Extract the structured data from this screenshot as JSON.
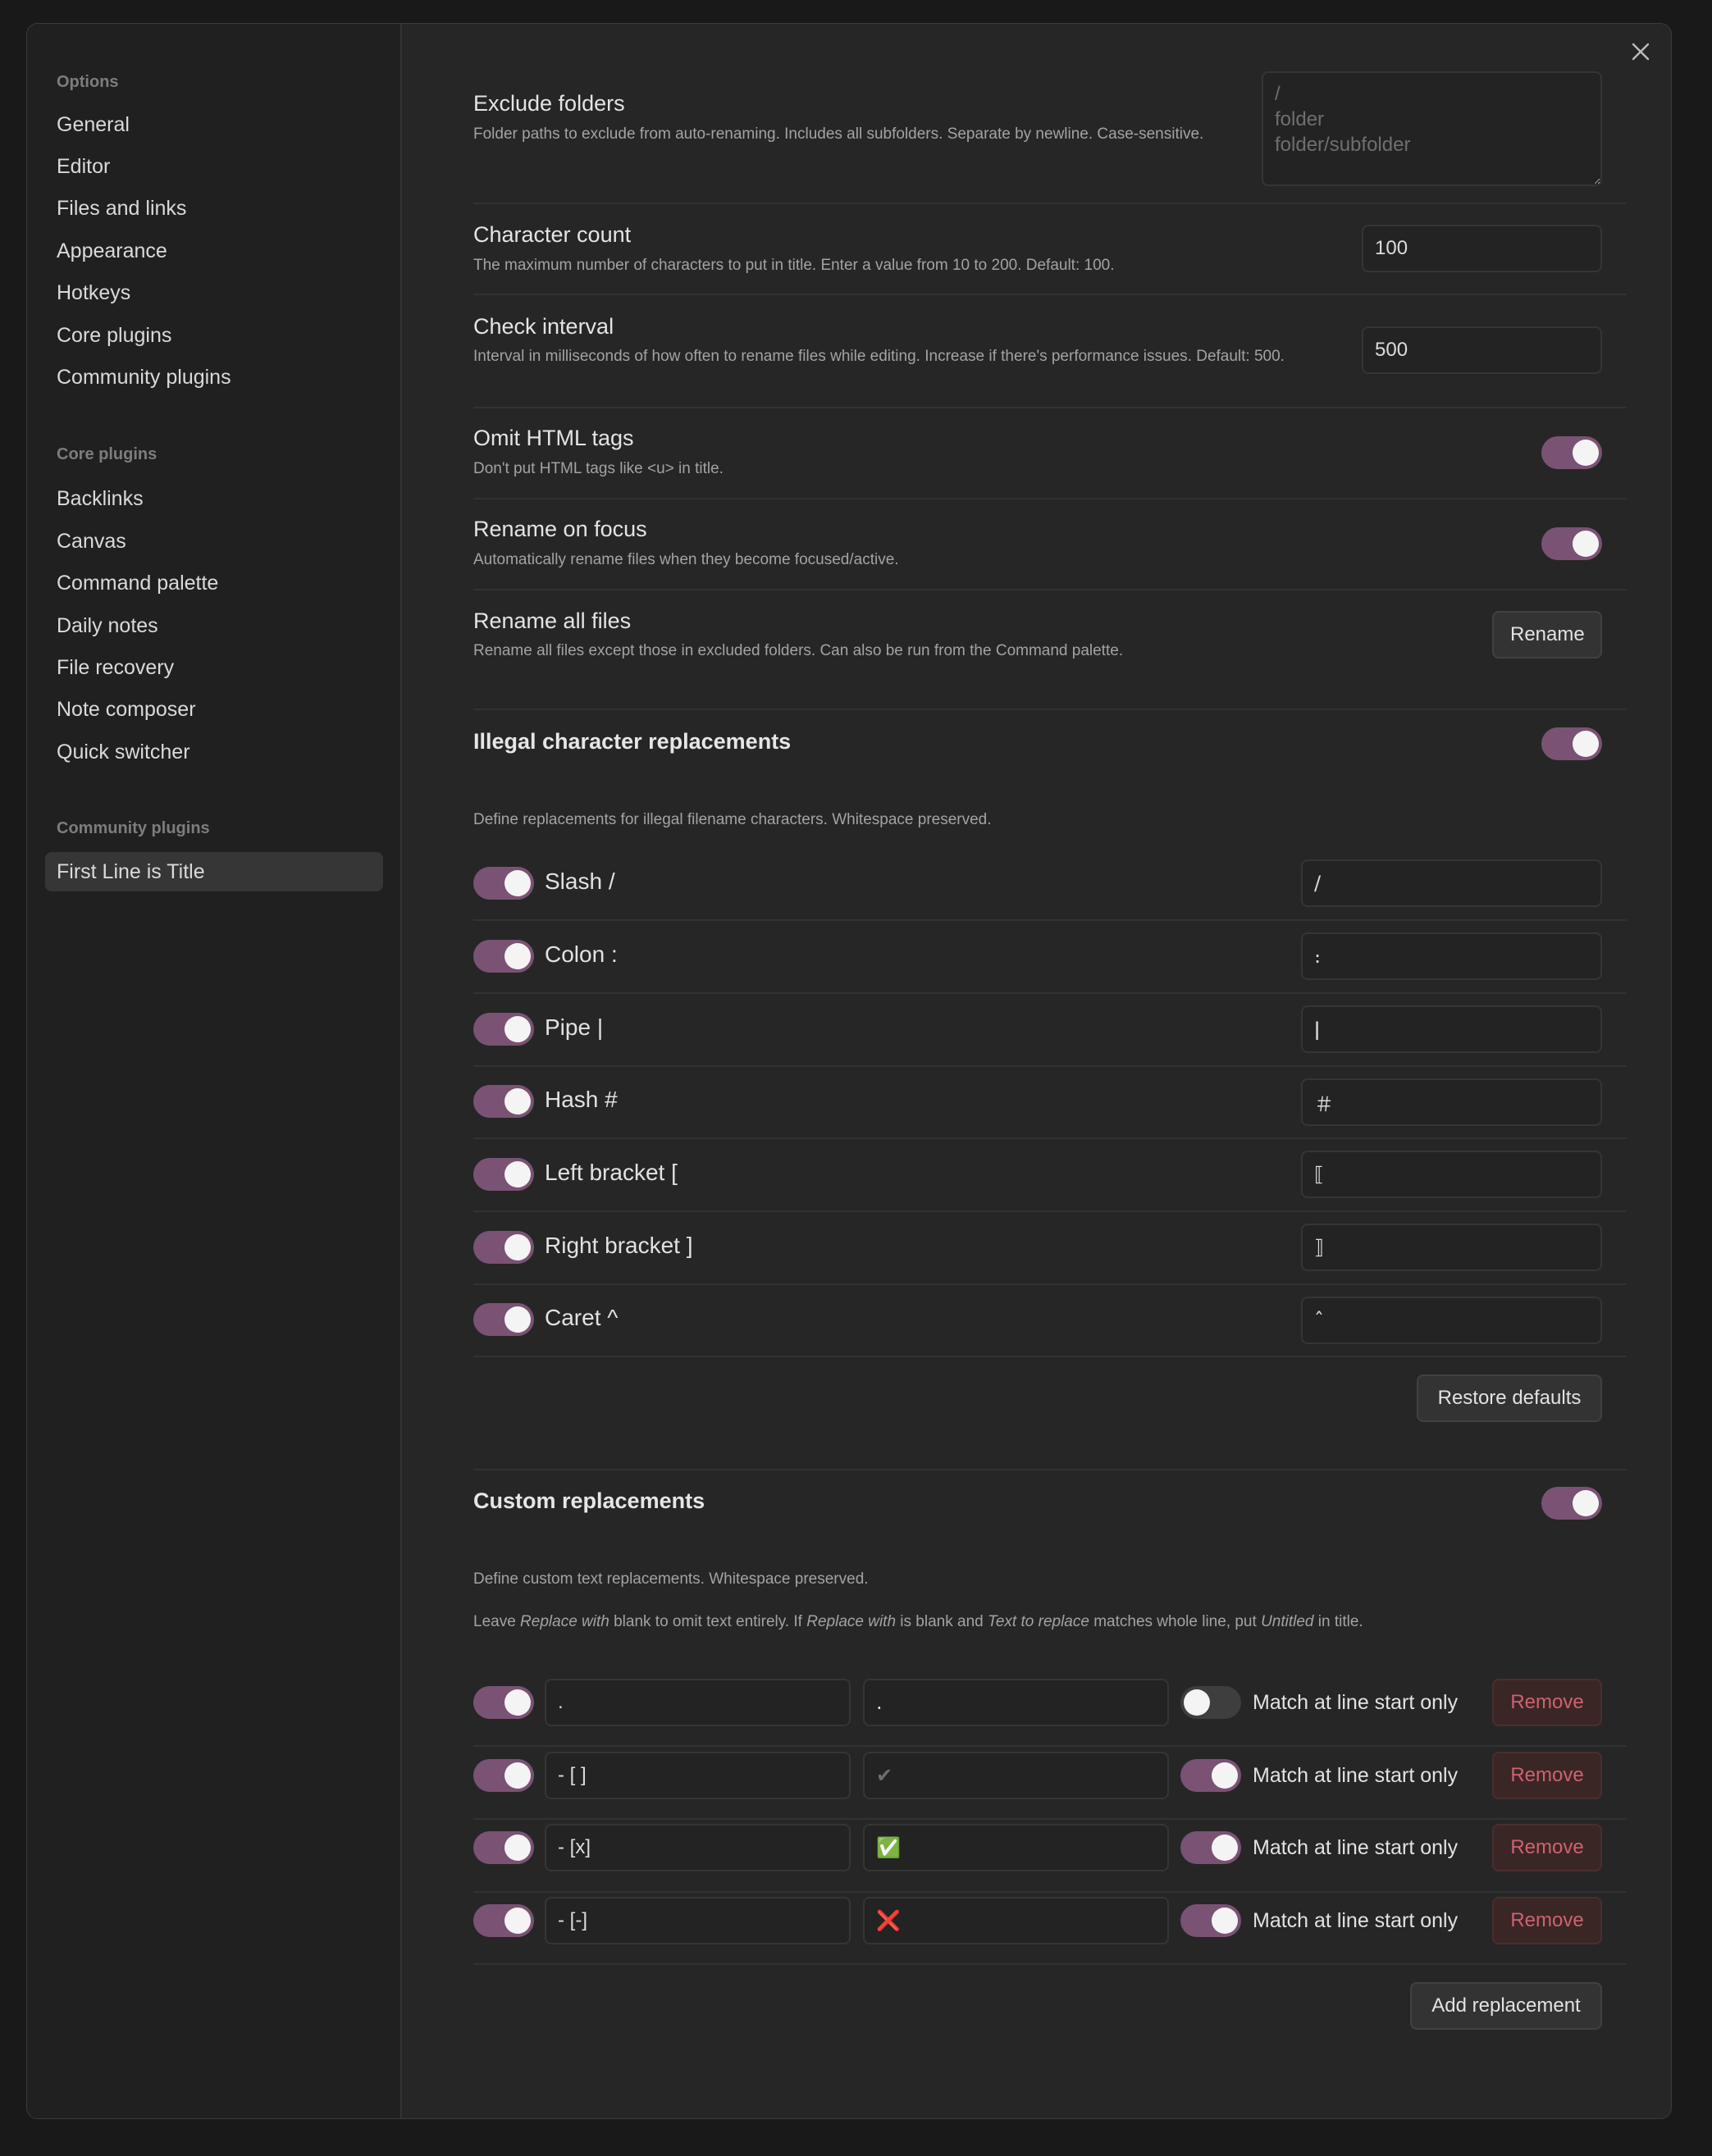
{
  "sidebar": {
    "groups": [
      {
        "label": "Options",
        "items": [
          "General",
          "Editor",
          "Files and links",
          "Appearance",
          "Hotkeys",
          "Core plugins",
          "Community plugins"
        ]
      },
      {
        "label": "Core plugins",
        "items": [
          "Backlinks",
          "Canvas",
          "Command palette",
          "Daily notes",
          "File recovery",
          "Note composer",
          "Quick switcher"
        ]
      },
      {
        "label": "Community plugins",
        "items": [
          "First Line is Title"
        ]
      }
    ]
  },
  "settings": {
    "exclude_folders": {
      "title": "Exclude folders",
      "desc": "Folder paths to exclude from auto-renaming. Includes all subfolders. Separate by newline. Case-sensitive.",
      "placeholder": "/\nfolder\nfolder/subfolder"
    },
    "character_count": {
      "title": "Character count",
      "desc": "The maximum number of characters to put in title. Enter a value from 10 to 200. Default: 100.",
      "value": "100"
    },
    "check_interval": {
      "title": "Check interval",
      "desc": "Interval in milliseconds of how often to rename files while editing. Increase if there's performance issues. Default: 500.",
      "value": "500"
    },
    "omit_html": {
      "title": "Omit HTML tags",
      "desc": "Don't put HTML tags like <u> in title.",
      "enabled": true
    },
    "rename_focus": {
      "title": "Rename on focus",
      "desc": "Automatically rename files when they become focused/active.",
      "enabled": true
    },
    "rename_all": {
      "title": "Rename all files",
      "desc": "Rename all files except those in excluded folders. Can also be run from the Command palette.",
      "button": "Rename"
    }
  },
  "illegal": {
    "heading": "Illegal character replacements",
    "enabled": true,
    "desc": "Define replacements for illegal filename characters. Whitespace preserved.",
    "items": [
      {
        "label": "Slash /",
        "value": "∕",
        "enabled": true
      },
      {
        "label": "Colon :",
        "value": "։",
        "enabled": true
      },
      {
        "label": "Pipe |",
        "value": "ǀ",
        "enabled": true
      },
      {
        "label": "Hash #",
        "value": "＃",
        "enabled": true
      },
      {
        "label": "Left bracket [",
        "value": "⟦",
        "enabled": true
      },
      {
        "label": "Right bracket ]",
        "value": "⟧",
        "enabled": true
      },
      {
        "label": "Caret ^",
        "value": "ˆ",
        "enabled": true
      }
    ],
    "restore_button": "Restore defaults"
  },
  "custom": {
    "heading": "Custom replacements",
    "enabled": true,
    "desc1": "Define custom text replacements. Whitespace preserved.",
    "desc2": {
      "t1": "Leave ",
      "i1": "Replace with",
      "t2": " blank to omit text entirely. If ",
      "i2": "Replace with",
      "t3": " is blank and ",
      "i3": "Text to replace",
      "t4": " matches whole line, put ",
      "i4": "Untitled",
      "t5": " in title."
    },
    "match_label": "Match at line start only",
    "remove_label": "Remove",
    "rows": [
      {
        "text": ".",
        "replace": ".",
        "enabled": true,
        "match_start": false
      },
      {
        "text": "- [ ]",
        "replace": "✔",
        "enabled": true,
        "match_start": true
      },
      {
        "text": "- [x]",
        "replace": "✅",
        "enabled": true,
        "match_start": true
      },
      {
        "text": "- [-]",
        "replace": "❌",
        "enabled": true,
        "match_start": true
      }
    ],
    "add_button": "Add replacement"
  },
  "colors": {
    "accent": "#7a5274",
    "remove": "#ce6270"
  }
}
